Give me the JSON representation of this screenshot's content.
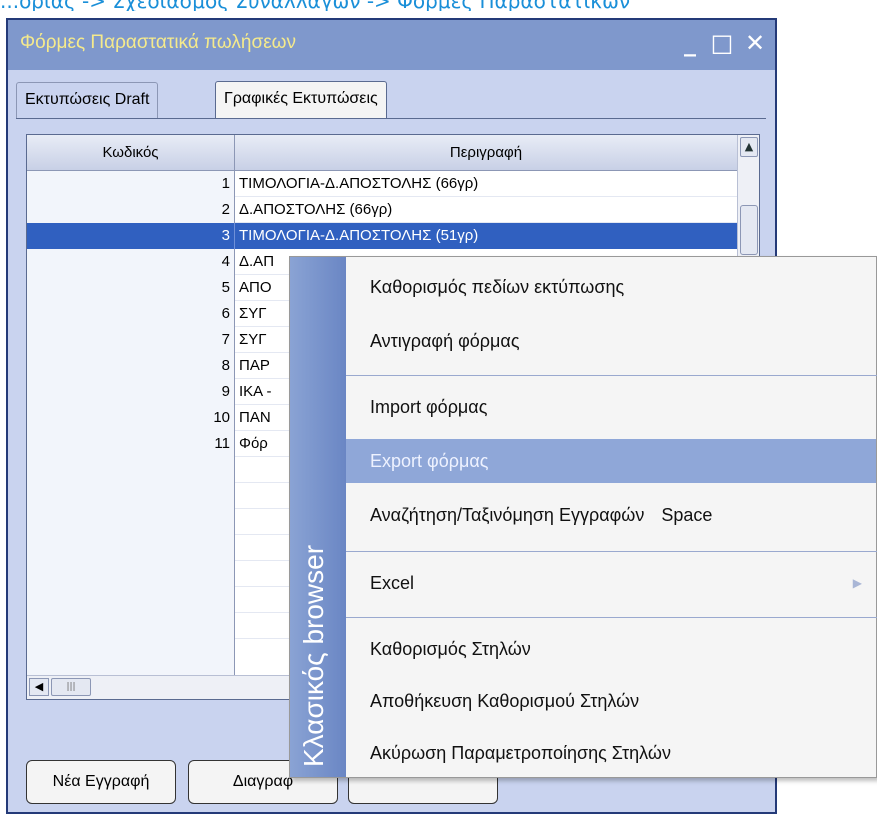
{
  "breadcrumb": "...ορίας -> Σχεδιασμός Συναλλαγών -> Φόρμες Παραστατικών",
  "window": {
    "title": "Φόρμες Παραστατικά πωλήσεων",
    "minimize": "_",
    "maximize": "□",
    "close": "✕"
  },
  "tabs": [
    {
      "label": "Εκτυπώσεις Draft",
      "active": false
    },
    {
      "label": "Γραφικές Εκτυπώσεις",
      "active": true
    }
  ],
  "grid": {
    "columns": [
      "Κωδικός",
      "Περιγραφή"
    ],
    "rows": [
      {
        "code": "1",
        "desc": "ΤΙΜΟΛΟΓΙΑ-Δ.ΑΠΟΣΤΟΛΗΣ (66γρ)"
      },
      {
        "code": "2",
        "desc": "Δ.ΑΠΟΣΤΟΛΗΣ (66γρ)"
      },
      {
        "code": "3",
        "desc": "ΤΙΜΟΛΟΓΙΑ-Δ.ΑΠΟΣΤΟΛΗΣ (51γρ)"
      },
      {
        "code": "4",
        "desc": "Δ.ΑΠ"
      },
      {
        "code": "5",
        "desc": "ΑΠΟ"
      },
      {
        "code": "6",
        "desc": "ΣΥΓ"
      },
      {
        "code": "7",
        "desc": "ΣΥΓ"
      },
      {
        "code": "8",
        "desc": "ΠΑΡ"
      },
      {
        "code": "9",
        "desc": "ΙΚΑ -"
      },
      {
        "code": "10",
        "desc": "ΠΑΝ"
      },
      {
        "code": "11",
        "desc": "Φόρ"
      }
    ],
    "selected_row": 3
  },
  "buttons": {
    "new": "Νέα Εγγραφή",
    "delete": "Διαγραφ"
  },
  "context_menu": {
    "strip_label": "Κλασικός browser",
    "items": [
      {
        "label": "Καθορισμός πεδίων εκτύπωσης"
      },
      {
        "label": "Αντιγραφή φόρμας"
      },
      {
        "label": "Import φόρμας"
      },
      {
        "label": "Export φόρμας",
        "highlighted": true
      },
      {
        "label": "Αναζήτηση/Ταξινόμηση Εγγραφών",
        "shortcut": "Space"
      },
      {
        "label": "Excel",
        "has_submenu": true
      },
      {
        "label": "Καθορισμός Στηλών"
      },
      {
        "label": "Αποθήκευση Καθορισμού Στηλών"
      },
      {
        "label": "Ακύρωση Παραμετροποίησης Στηλών"
      }
    ]
  },
  "colors": {
    "title_bar": "#7f98cc",
    "title_text": "#f5ea8c",
    "selection": "#3060c0",
    "menu_highlight": "#8fa7d8"
  }
}
